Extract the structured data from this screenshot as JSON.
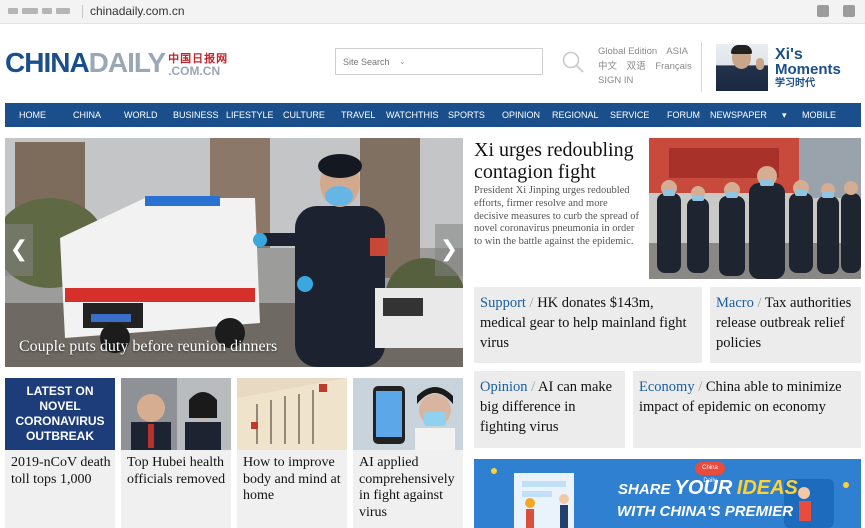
{
  "browser": {
    "url": "chinadaily.com.cn"
  },
  "header": {
    "logo_main": "CHINA",
    "logo_secondary": "DAILY",
    "logo_cn": "中国日报网",
    "logo_domain": ".COM.CN",
    "search_placeholder": "Site Search",
    "edition": {
      "global": "Global Edition",
      "asia": "ASIA",
      "chinese": "中文",
      "bilingual": "双语",
      "french": "Français",
      "signin": "SIGN IN"
    },
    "xi_moments": {
      "line1": "Xi's",
      "line2": "Moments",
      "line3": "学习时代"
    }
  },
  "nav": {
    "items": [
      "HOME",
      "CHINA",
      "WORLD",
      "BUSINESS",
      "LIFESTYLE",
      "CULTURE",
      "TRAVEL",
      "WATCHTHIS",
      "SPORTS",
      "OPINION",
      "REGIONAL",
      "SERVICE",
      "FORUM",
      "NEWSPAPER",
      "▾",
      "MOBILE"
    ]
  },
  "hero": {
    "caption": "Couple puts duty before reunion dinners",
    "prev": "❮",
    "next": "❯"
  },
  "headline": {
    "title": "Xi urges redoubling contagion fight",
    "summary": "President Xi Jinping urges redoubled efforts, firmer resolve and more decisive measures to curb the spread of novel coronavirus pneumonia in order to win the battle against the epidemic."
  },
  "news_boxes": [
    {
      "category": "Support",
      "text": "HK donates $143m, medical gear to help mainland fight virus"
    },
    {
      "category": "Macro",
      "text": "Tax authorities release outbreak relief policies"
    },
    {
      "category": "Opinion",
      "text": "AI can make big difference in fighting virus"
    },
    {
      "category": "Economy",
      "text": "China able to minimize impact of epidemic on economy"
    }
  ],
  "cards": [
    {
      "thumb_title": "LATEST ON NOVEL CORONAVIRUS OUTBREAK",
      "text": "2019-nCoV death toll tops 1,000"
    },
    {
      "text": "Top Hubei health officials removed"
    },
    {
      "text": "How to improve body and mind at home"
    },
    {
      "text": "AI applied comprehensively in fight against virus"
    }
  ],
  "banner": {
    "badge": "China Daily",
    "share": "SHARE",
    "your": "YOUR",
    "ideas": "IDEAS",
    "line2": "WITH CHINA'S PREMIER"
  },
  "colors": {
    "brand_blue": "#1a4f8b",
    "category_blue": "#1a5e9e",
    "box_grey": "#ececec"
  }
}
